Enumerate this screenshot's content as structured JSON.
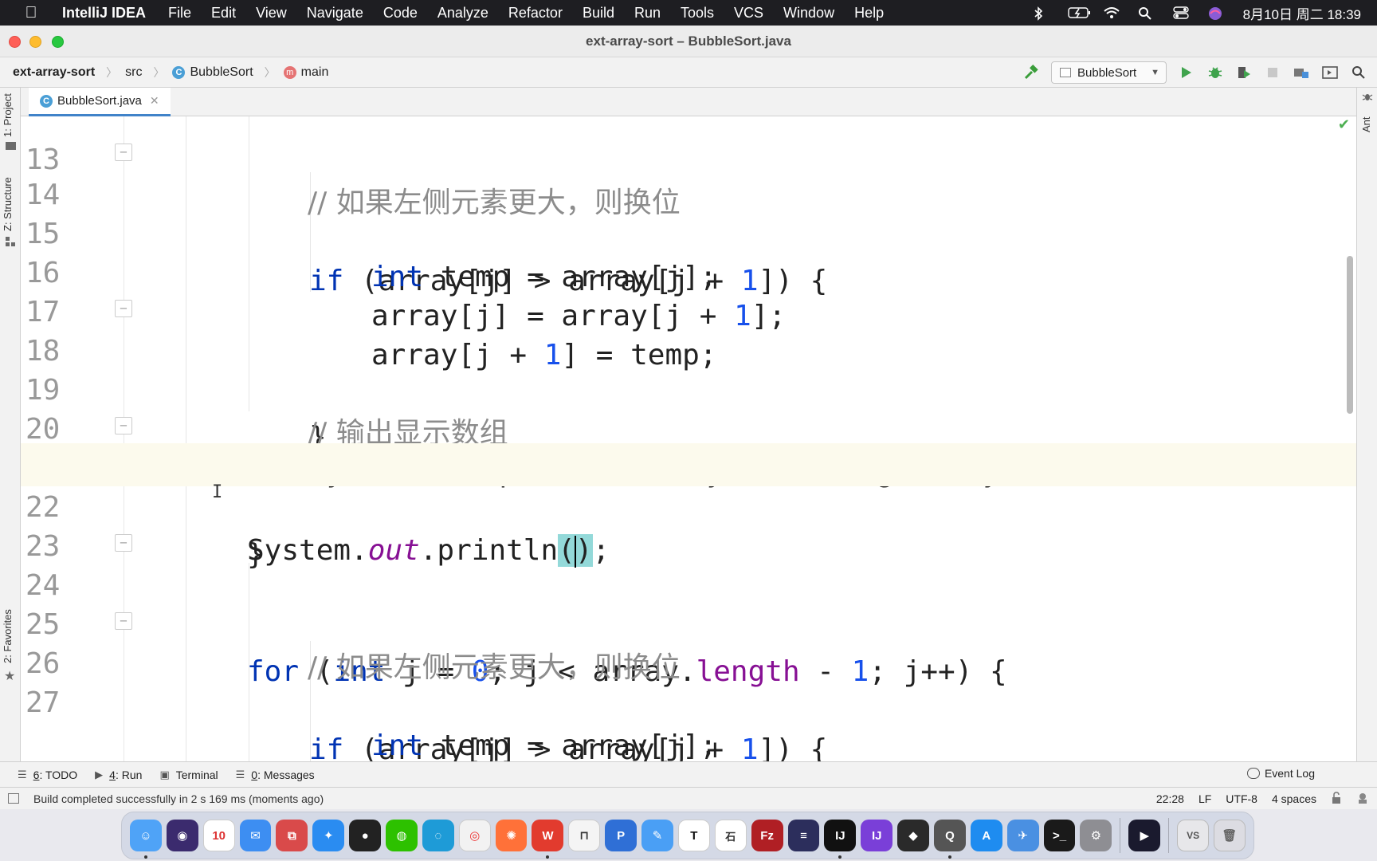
{
  "menubar": {
    "app_name": "IntelliJ IDEA",
    "items": [
      "File",
      "Edit",
      "View",
      "Navigate",
      "Code",
      "Analyze",
      "Refactor",
      "Build",
      "Run",
      "Tools",
      "VCS",
      "Window",
      "Help"
    ],
    "clock": "8月10日 周二 18:39"
  },
  "window": {
    "title": "ext-array-sort – BubbleSort.java"
  },
  "breadcrumbs": {
    "project": "ext-array-sort",
    "folder": "src",
    "class": "BubbleSort",
    "method": "main"
  },
  "run_config": {
    "name": "BubbleSort"
  },
  "tool_tabs": {
    "project": "1: Project",
    "structure": "Z: Structure",
    "favorites": "2: Favorites",
    "ant": "Ant"
  },
  "editor_tab": {
    "filename": "BubbleSort.java"
  },
  "code_lines": [
    {
      "no": "13",
      "text": "            // 如果左侧元素更大，则换位"
    },
    {
      "no": "14",
      "text": "            if (array[j] > array[j + 1]) {"
    },
    {
      "no": "15",
      "text": "                int temp = array[j];"
    },
    {
      "no": "16",
      "text": "                array[j] = array[j + 1];"
    },
    {
      "no": "17",
      "text": "                array[j + 1] = temp;"
    },
    {
      "no": "18",
      "text": "            }"
    },
    {
      "no": "19",
      "text": "            // 输出显示数组"
    },
    {
      "no": "20",
      "text": "            System.out.println(Arrays.toString(array));"
    },
    {
      "no": "21",
      "text": "        }"
    },
    {
      "no": "22",
      "text": "        System.out.println();"
    },
    {
      "no": "23",
      "text": ""
    },
    {
      "no": "24",
      "text": "        for (int j = 0; j < array.length - 1; j++) {"
    },
    {
      "no": "25",
      "text": "            // 如果左侧元素更大，则换位"
    },
    {
      "no": "26",
      "text": "            if (array[j] > array[j + 1]) {"
    },
    {
      "no": "27",
      "text": "                int temp = array[j];"
    }
  ],
  "bottom_tools": {
    "todo_num": "6",
    "todo": ": TODO",
    "run_num": "4",
    "run": ": Run",
    "terminal": "Terminal",
    "messages_num": "0",
    "messages": ": Messages",
    "event_log": "Event Log"
  },
  "status": {
    "message": "Build completed successfully in 2 s 169 ms (moments ago)",
    "position": "22:28",
    "line_ending": "LF",
    "encoding": "UTF-8",
    "indent": "4 spaces"
  },
  "dock": {
    "calendar_day": "10"
  },
  "colors": {
    "keyword": "#0033b3",
    "number": "#1750eb",
    "comment": "#8c8c8c",
    "static_field": "#871094",
    "current_line": "#fcfaed",
    "bracket_match": "#93d9d9"
  }
}
